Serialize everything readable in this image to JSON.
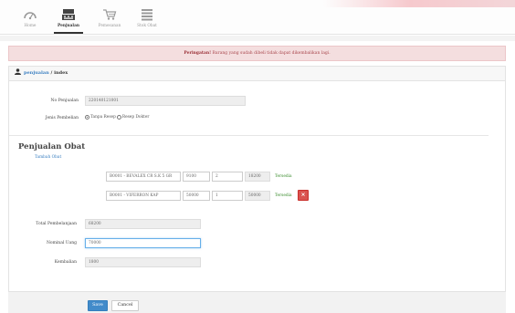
{
  "nav": {
    "items": [
      {
        "label": "Home",
        "icon": "dashboard-icon"
      },
      {
        "label": "Penjualan",
        "icon": "register-icon",
        "active": true
      },
      {
        "label": "Pemesanan",
        "icon": "cart-icon"
      },
      {
        "label": "Stok Obat",
        "icon": "list-icon"
      }
    ]
  },
  "alert": {
    "strong": "Peringatan!",
    "text": " Barang yang sudah dibeli tidak dapat dikembalikan lagi."
  },
  "breadcrumb": {
    "section": "penjualan",
    "separator": " / ",
    "page": "index"
  },
  "form": {
    "no_penjualan_label": "No Penjualan",
    "no_penjualan_value": "220140121001",
    "jenis_label": "Jenis Pembelian",
    "jenis_options": [
      {
        "label": "Tanpa Resep",
        "checked": true
      },
      {
        "label": "Resep Dokter",
        "checked": false
      }
    ]
  },
  "obat": {
    "title": "Penjualan Obat",
    "add_link": "Tambah Obat",
    "rows": [
      {
        "product": "B0001 - BEVALEX CR S.K 5 GR",
        "price": "9100",
        "qty": "2",
        "subtotal": "18200",
        "status": "Tersedia",
        "removable": false
      },
      {
        "product": "B0001 - VIFERRON KAP",
        "price": "50000",
        "qty": "1",
        "subtotal": "50000",
        "status": "Tersedia",
        "removable": true
      }
    ],
    "remove_glyph": "×"
  },
  "totals": {
    "total_label": "Total Pembelanjaan",
    "total_value": "68200",
    "nominal_label": "Nominal Uang",
    "nominal_value": "70000",
    "kembalian_label": "Kembalian",
    "kembalian_value": "1800"
  },
  "actions": {
    "save": "Save",
    "cancel": "Cancel"
  },
  "colors": {
    "alert_bg": "#f4dedf",
    "primary": "#428bca",
    "danger": "#d9534f",
    "success_text": "#3c8d2f"
  }
}
